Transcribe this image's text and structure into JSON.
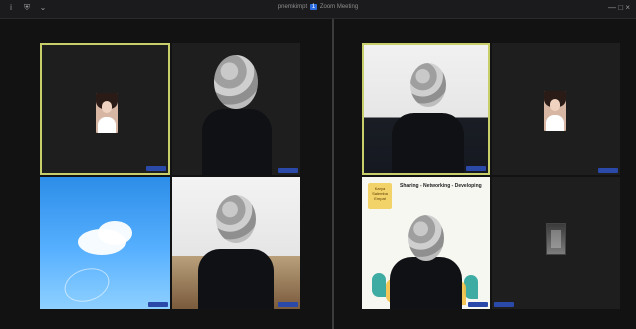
{
  "window": {
    "title_left": "pnemkimpt",
    "title_badge": "1",
    "title_right": "Zoom Meeting"
  },
  "left": {
    "tiles": [
      {
        "name_tag": ""
      },
      {
        "name_tag": ""
      },
      {
        "name_tag": ""
      },
      {
        "name_tag": ""
      }
    ]
  },
  "right": {
    "tiles": [
      {
        "name_tag": ""
      },
      {
        "name_tag": ""
      },
      {
        "name_tag": ""
      },
      {
        "name_tag": ""
      }
    ],
    "banner": {
      "logo_text": "Karya Salemba Empat",
      "headline": "Sharing - Networking - Developing"
    }
  },
  "colors": {
    "active_border": "#c8cf6a",
    "name_tag_bg": "#2a49a8"
  }
}
